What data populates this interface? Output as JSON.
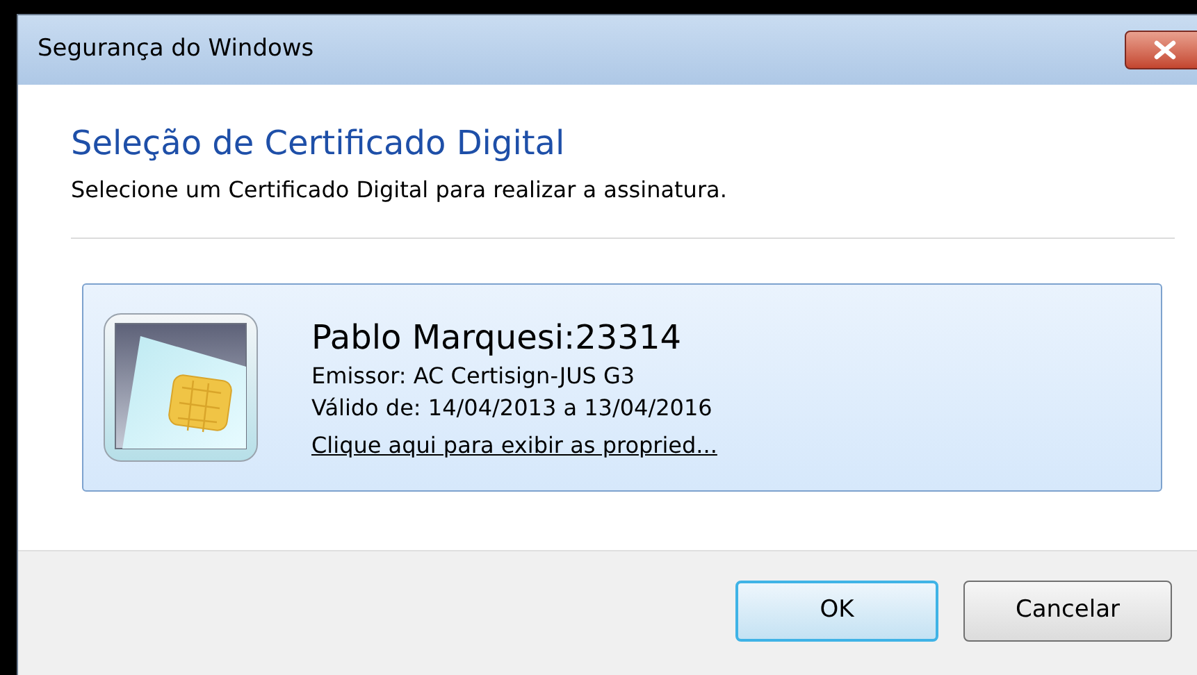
{
  "window": {
    "title": "Segurança do Windows"
  },
  "heading": "Seleção de Certificado Digital",
  "instruction": "Selecione um Certificado Digital para realizar a assinatura.",
  "certificate": {
    "name": "Pablo Marquesi:23314",
    "issuer": "Emissor: AC Certisign-JUS G3",
    "validity": "Válido de: 14/04/2013 a 13/04/2016",
    "link": "Clique aqui para exibir as propried...",
    "selected": true
  },
  "buttons": [
    {
      "label": "OK",
      "default": true
    },
    {
      "label": "Cancelar",
      "default": false
    }
  ]
}
